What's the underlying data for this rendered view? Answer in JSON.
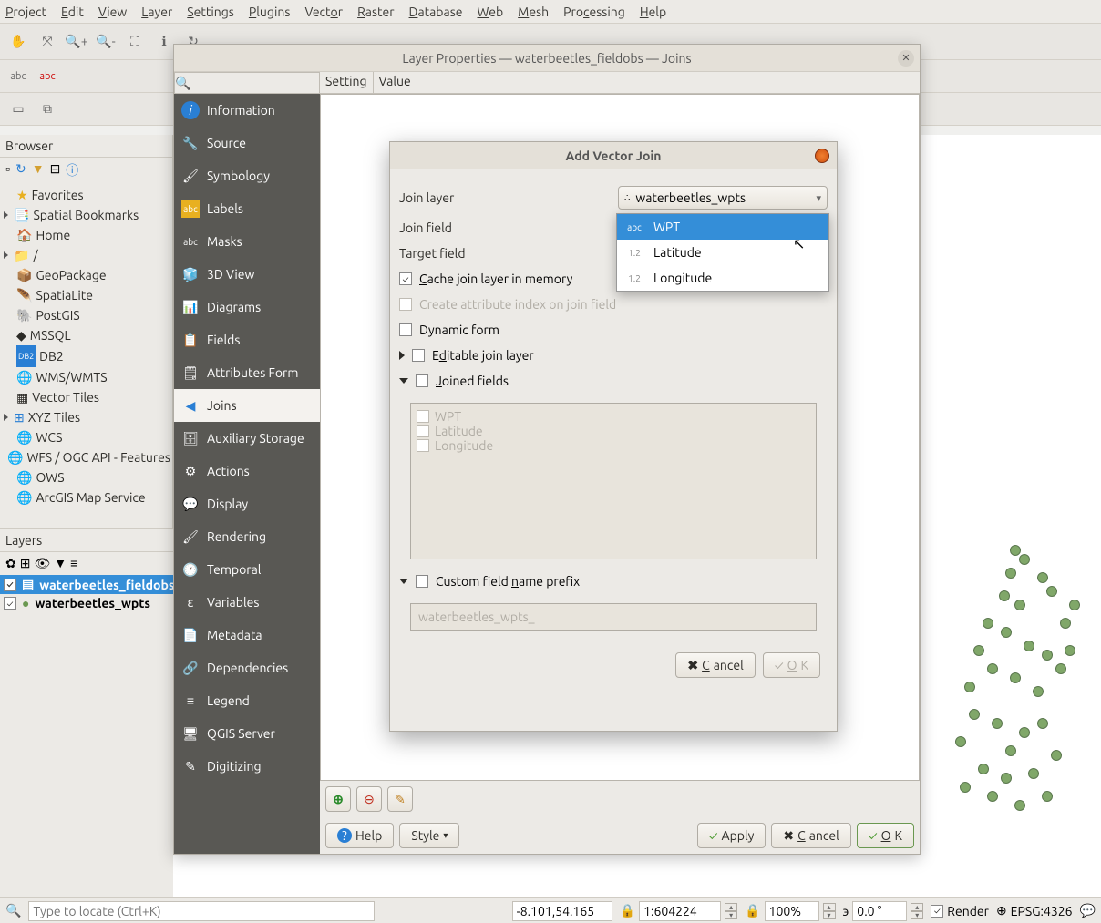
{
  "menubar": [
    "Project",
    "Edit",
    "View",
    "Layer",
    "Settings",
    "Plugins",
    "Vector",
    "Raster",
    "Database",
    "Web",
    "Mesh",
    "Processing",
    "Help"
  ],
  "browser": {
    "title": "Browser",
    "items": [
      "Favorites",
      "Spatial Bookmarks",
      "Home",
      "/",
      "GeoPackage",
      "SpatiaLite",
      "PostGIS",
      "MSSQL",
      "DB2",
      "WMS/WMTS",
      "Vector Tiles",
      "XYZ Tiles",
      "WCS",
      "WFS / OGC API - Features",
      "OWS",
      "ArcGIS Map Service"
    ]
  },
  "layers": {
    "title": "Layers",
    "items": [
      {
        "name": "waterbeetles_fieldobs",
        "checked": true,
        "selected": true
      },
      {
        "name": "waterbeetles_wpts",
        "checked": true,
        "selected": false
      }
    ]
  },
  "props_dialog": {
    "title": "Layer Properties — waterbeetles_fieldobs — Joins",
    "tabs": [
      "Information",
      "Source",
      "Symbology",
      "Labels",
      "Masks",
      "3D View",
      "Diagrams",
      "Fields",
      "Attributes Form",
      "Joins",
      "Auxiliary Storage",
      "Actions",
      "Display",
      "Rendering",
      "Temporal",
      "Variables",
      "Metadata",
      "Dependencies",
      "Legend",
      "QGIS Server",
      "Digitizing"
    ],
    "active_tab": "Joins",
    "table_headers": [
      "Setting",
      "Value"
    ],
    "btn_help": "Help",
    "btn_style": "Style",
    "btn_apply": "Apply",
    "btn_cancel": "Cancel",
    "btn_ok": "OK"
  },
  "join_dialog": {
    "title": "Add Vector Join",
    "join_layer_label": "Join layer",
    "join_layer_value": "waterbeetles_wpts",
    "join_field_label": "Join field",
    "target_field_label": "Target field",
    "cache_label": "Cache join layer in memory",
    "index_label": "Create attribute index on join field",
    "dynamic_label": "Dynamic form",
    "editable_label": "Editable join layer",
    "joined_fields_label": "Joined fields",
    "joined_fields": [
      "WPT",
      "Latitude",
      "Longitude"
    ],
    "prefix_label": "Custom field name prefix",
    "prefix_value": "waterbeetles_wpts_",
    "btn_cancel": "Cancel",
    "btn_ok": "OK"
  },
  "dropdown": {
    "items": [
      {
        "type": "abc",
        "label": "WPT",
        "selected": true
      },
      {
        "type": "1.2",
        "label": "Latitude",
        "selected": false
      },
      {
        "type": "1.2",
        "label": "Longitude",
        "selected": false
      }
    ]
  },
  "statusbar": {
    "locate_placeholder": "Type to locate (Ctrl+K)",
    "coords": "-8.101,54.165",
    "scale": "1:604224",
    "mag": "100%",
    "rot": "0.0 °",
    "render": "Render",
    "crs": "EPSG:4326"
  }
}
